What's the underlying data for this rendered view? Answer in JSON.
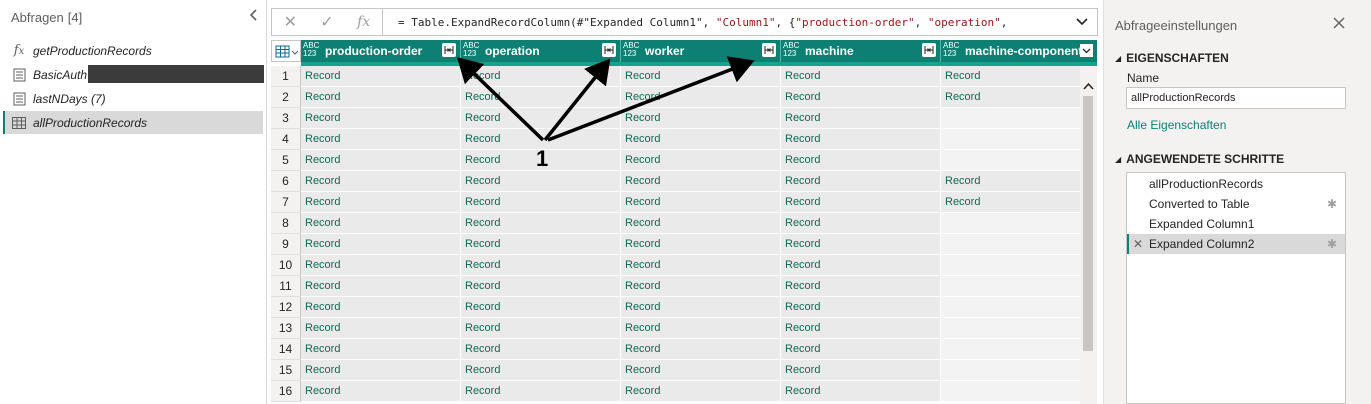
{
  "queries": {
    "header": "Abfragen",
    "count": "[4]",
    "items": [
      {
        "label": "getProductionRecords",
        "icon": "function-icon"
      },
      {
        "label": "BasicAuth",
        "icon": "table-query-icon"
      },
      {
        "label": "lastNDays (7)",
        "icon": "table-query-icon"
      },
      {
        "label": "allProductionRecords",
        "icon": "table-icon"
      }
    ]
  },
  "formula": {
    "cancel": "✕",
    "commit": "✓",
    "fx": "fx",
    "prefix": "= Table.ExpandRecordColumn(#\"Expanded Column1\", ",
    "str1": "\"Column1\"",
    "mid": ", {",
    "str2": "\"production-order\"",
    "sep": ", ",
    "str3": "\"operation\"",
    "suffix": ","
  },
  "grid": {
    "type_label_top": "ABC",
    "type_label_bottom": "123",
    "columns": [
      "production-order",
      "operation",
      "worker",
      "machine",
      "machine-component"
    ],
    "rows": [
      {
        "n": "1",
        "cells": [
          "Record",
          "Record",
          "Record",
          "Record",
          "Record"
        ]
      },
      {
        "n": "2",
        "cells": [
          "Record",
          "Record",
          "Record",
          "Record",
          "Record"
        ]
      },
      {
        "n": "3",
        "cells": [
          "Record",
          "Record",
          "Record",
          "Record",
          ""
        ]
      },
      {
        "n": "4",
        "cells": [
          "Record",
          "Record",
          "Record",
          "Record",
          ""
        ]
      },
      {
        "n": "5",
        "cells": [
          "Record",
          "Record",
          "Record",
          "Record",
          ""
        ]
      },
      {
        "n": "6",
        "cells": [
          "Record",
          "Record",
          "Record",
          "Record",
          "Record"
        ]
      },
      {
        "n": "7",
        "cells": [
          "Record",
          "Record",
          "Record",
          "Record",
          "Record"
        ]
      },
      {
        "n": "8",
        "cells": [
          "Record",
          "Record",
          "Record",
          "Record",
          ""
        ]
      },
      {
        "n": "9",
        "cells": [
          "Record",
          "Record",
          "Record",
          "Record",
          ""
        ]
      },
      {
        "n": "10",
        "cells": [
          "Record",
          "Record",
          "Record",
          "Record",
          ""
        ]
      },
      {
        "n": "11",
        "cells": [
          "Record",
          "Record",
          "Record",
          "Record",
          ""
        ]
      },
      {
        "n": "12",
        "cells": [
          "Record",
          "Record",
          "Record",
          "Record",
          ""
        ]
      },
      {
        "n": "13",
        "cells": [
          "Record",
          "Record",
          "Record",
          "Record",
          ""
        ]
      },
      {
        "n": "14",
        "cells": [
          "Record",
          "Record",
          "Record",
          "Record",
          ""
        ]
      },
      {
        "n": "15",
        "cells": [
          "Record",
          "Record",
          "Record",
          "Record",
          ""
        ]
      },
      {
        "n": "16",
        "cells": [
          "Record",
          "Record",
          "Record",
          "Record",
          ""
        ]
      }
    ]
  },
  "settings": {
    "title": "Abfrageeinstellungen",
    "properties_header": "EIGENSCHAFTEN",
    "name_label": "Name",
    "name_value": "allProductionRecords",
    "all_properties_link": "Alle Eigenschaften",
    "steps_header": "ANGEWENDETE SCHRITTE",
    "steps": [
      {
        "label": "allProductionRecords",
        "gear": false
      },
      {
        "label": "Converted to Table",
        "gear": true
      },
      {
        "label": "Expanded Column1",
        "gear": false
      },
      {
        "label": "Expanded Column2",
        "gear": true,
        "selected": true
      }
    ]
  },
  "annotation": {
    "label": "1"
  },
  "colors": {
    "header_teal": "#0e7f73",
    "record_green": "#0e6b53",
    "quality_bar": "#14a38b"
  }
}
